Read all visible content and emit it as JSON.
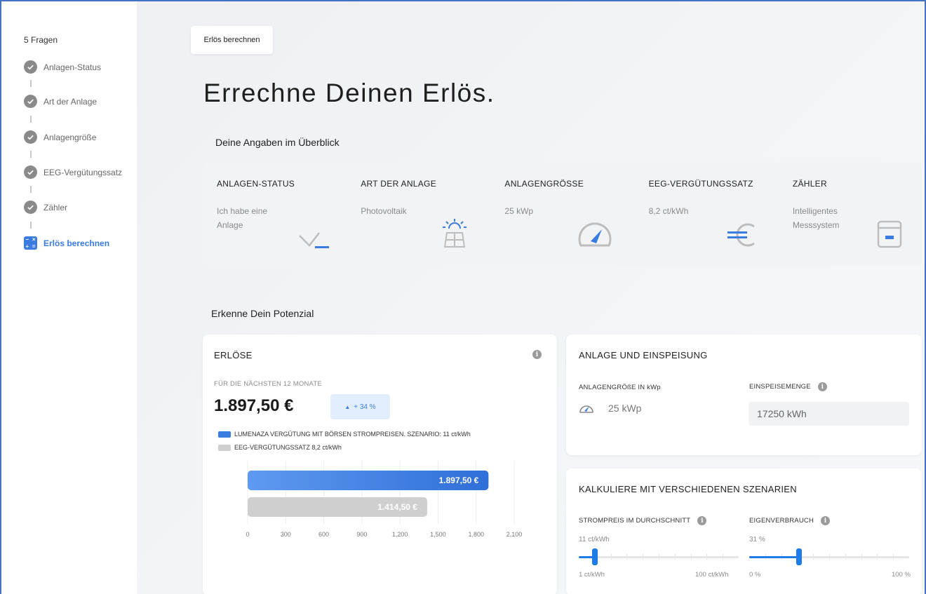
{
  "sidebar": {
    "count_label": "5 Fragen",
    "steps": [
      {
        "label": "Anlagen-Status"
      },
      {
        "label": "Art der Anlage"
      },
      {
        "label": "Anlagengröße"
      },
      {
        "label": "EEG-Vergütungssatz"
      },
      {
        "label": "Zähler"
      }
    ],
    "active_step": {
      "label": "Erlös berechnen"
    }
  },
  "breadcrumb": {
    "label": "Erlös berechnen"
  },
  "headline": "Errechne Deinen Erlös.",
  "overview": {
    "title": "Deine Angaben im Überblick",
    "cards": [
      {
        "label": "ANLAGEN-STATUS",
        "value": "Ich habe eine Anlage",
        "icon": "check-icon"
      },
      {
        "label": "ART DER ANLAGE",
        "value": "Photovoltaik",
        "icon": "solar-panel-icon"
      },
      {
        "label": "ANLAGENGRÖSSE",
        "value": "25 kWp",
        "icon": "gauge-icon"
      },
      {
        "label": "EEG-VERGÜTUNGSSATZ",
        "value": "8,2 ct/kWh",
        "icon": "euro-icon"
      },
      {
        "label": "ZÄHLER",
        "value": "Intelligentes Messsystem",
        "icon": "meter-icon"
      }
    ]
  },
  "potential": {
    "title": "Erkenne Dein Potenzial",
    "revenue": {
      "title": "ERLÖSE",
      "period": "FÜR DIE NÄCHSTEN 12 MONATE",
      "amount": "1.897,50 €",
      "change": "+ 34 %",
      "legend": [
        {
          "label": "LUMENAZA VERGÜTUNG MIT BÖRSEN STROMPREISEN. SZENARIO: 11 ct/kWh",
          "color": "#3a7be0"
        },
        {
          "label": "EEG-VERGÜTUNGSSATZ 8,2 ct/kWh",
          "color": "#cfcfcf"
        }
      ]
    },
    "plant": {
      "title": "ANLAGE UND EINSPEISUNG",
      "size_label": "ANLAGENGRÖßE IN kWp",
      "size_value": "25 kWp",
      "feed_label": "EINSPEISEMENGE",
      "feed_value": "17250 kWh"
    },
    "scenarios": {
      "title": "KALKULIERE MIT VERSCHIEDENEN SZENARIEN",
      "price": {
        "label": "STROMPREIS IM DURCHSCHNITT",
        "value": "11 ct/kWh",
        "min": "1 ct/kWh",
        "max": "100 ct/kWh",
        "level": 0.1
      },
      "consumption": {
        "label": "EIGENVERBRAUCH",
        "value": "31 %",
        "min": "0 %",
        "max": "100 %",
        "level": 0.31
      }
    }
  },
  "chart_data": {
    "type": "bar",
    "orientation": "horizontal",
    "series": [
      {
        "name": "LUMENAZA VERGÜTUNG MIT BÖRSEN STROMPREISEN. SZENARIO: 11 ct/kWh",
        "value": 1897.5,
        "label": "1.897,50 €",
        "color": "#3a7be0"
      },
      {
        "name": "EEG-VERGÜTUNGSSATZ 8,2 ct/kWh",
        "value": 1414.5,
        "label": "1.414,50 €",
        "color": "#cfcfcf"
      }
    ],
    "xticks": [
      "0",
      "300",
      "600",
      "900",
      "1,200",
      "1,500",
      "1,800",
      "2,100"
    ],
    "xlim": [
      0,
      2100
    ],
    "grid": true
  }
}
